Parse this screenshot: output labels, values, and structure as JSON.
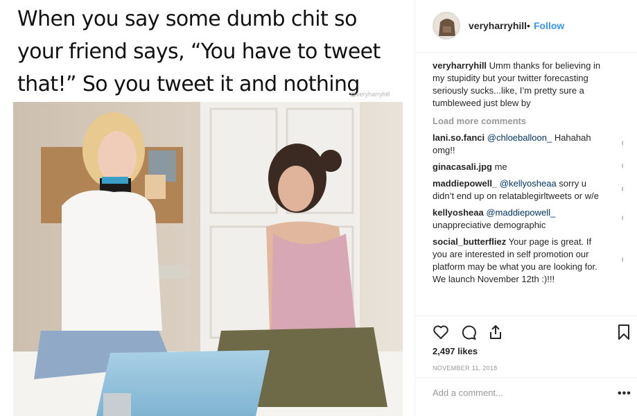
{
  "post": {
    "meme_text": "When you say some dumb chit so your friend says, “You have to tweet that!” So you tweet it and nothing happens",
    "watermark": "@veryharryhill"
  },
  "header": {
    "username": "veryharryhill",
    "separator": "•",
    "follow_label": "Follow"
  },
  "caption": {
    "username": "veryharryhill",
    "text": " Umm thanks for believing in my stupidity but your twitter forecasting seriously sucks...like, I’m pretty sure a tumbleweed just blew by"
  },
  "load_more_label": "Load more comments",
  "comments": [
    {
      "username": "lani.so.fanci",
      "mention": "@chloeballoon_",
      "text": " Hahahah omg!!"
    },
    {
      "username": "ginacasali.jpg",
      "mention": "",
      "text": " me"
    },
    {
      "username": "maddiepowell_",
      "mention": "@kellyosheaa",
      "text": " sorry u didn’t end up on relatablegirltweets or w/e"
    },
    {
      "username": "kellyosheaa",
      "mention": "@maddiepowell_",
      "text": " unappreciative demographic"
    },
    {
      "username": "social_butterfliez",
      "mention": "",
      "text": " Your page is great. If you are interested in self promotion our platform may be what you are looking for. We launch November 12th :)!!!"
    }
  ],
  "likes": "2,497 likes",
  "date": "NOVEMBER 11, 2018",
  "add_comment": {
    "placeholder": "Add a comment..."
  },
  "more_options": "•••",
  "colors": {
    "link_blue": "#3897f0",
    "mention_blue": "#003569",
    "muted": "#999999",
    "border": "#efefef"
  },
  "icons": [
    "heart-icon",
    "comment-icon",
    "share-icon",
    "bookmark-icon"
  ]
}
